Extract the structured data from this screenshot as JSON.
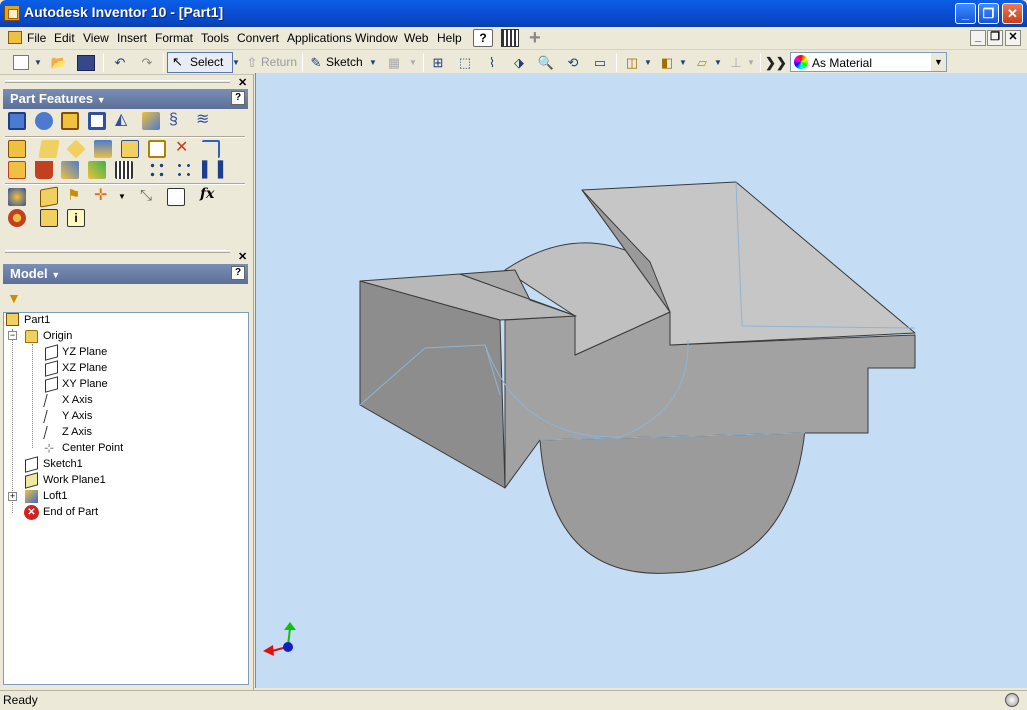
{
  "window": {
    "title": "Autodesk Inventor 10 - [Part1]"
  },
  "menu": [
    "File",
    "Edit",
    "View",
    "Insert",
    "Format",
    "Tools",
    "Convert",
    "Applications",
    "Window",
    "Web",
    "Help"
  ],
  "toolbar": {
    "select": "Select",
    "return": "Return",
    "sketch": "Sketch",
    "material": "As Material"
  },
  "panel": {
    "title": "Part Features"
  },
  "browser": {
    "title": "Model",
    "tree": [
      "Part1",
      "Origin",
      "YZ Plane",
      "XZ Plane",
      "XY Plane",
      "X Axis",
      "Y Axis",
      "Z Axis",
      "Center Point",
      "Sketch1",
      "Work Plane1",
      "Loft1",
      "End of Part"
    ]
  },
  "status": "Ready",
  "colors": {
    "title_blue": "#0b4fd6",
    "viewport_bg": "#c4dcf4",
    "panel_header": "#6b7fa8",
    "model_gray": "#9a9a9a"
  },
  "icons": {
    "formula": "fx"
  }
}
